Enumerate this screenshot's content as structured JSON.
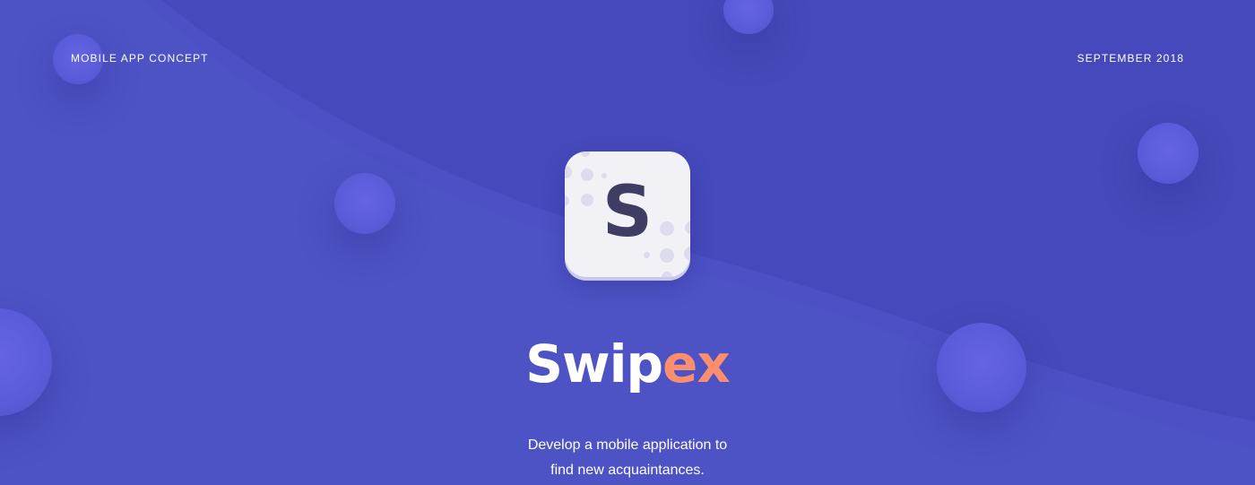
{
  "header": {
    "left_label": "MOBILE APP CONCEPT",
    "right_label": "SEPTEMBER 2018"
  },
  "app_icon": {
    "letter": "S",
    "icon_name": "app-logo-icon"
  },
  "brand": {
    "name_part1": "Swip",
    "name_part2": "ex"
  },
  "tagline": {
    "line1": "Develop a mobile application to",
    "line2": "find new acquaintances."
  },
  "colors": {
    "background": "#4649BB",
    "wave": "#4C50C4",
    "bubble": "#5B5CDA",
    "accent_orange": "#FB8E6C",
    "icon_bg": "#F1F1F6",
    "icon_letter": "#3F3D64"
  }
}
